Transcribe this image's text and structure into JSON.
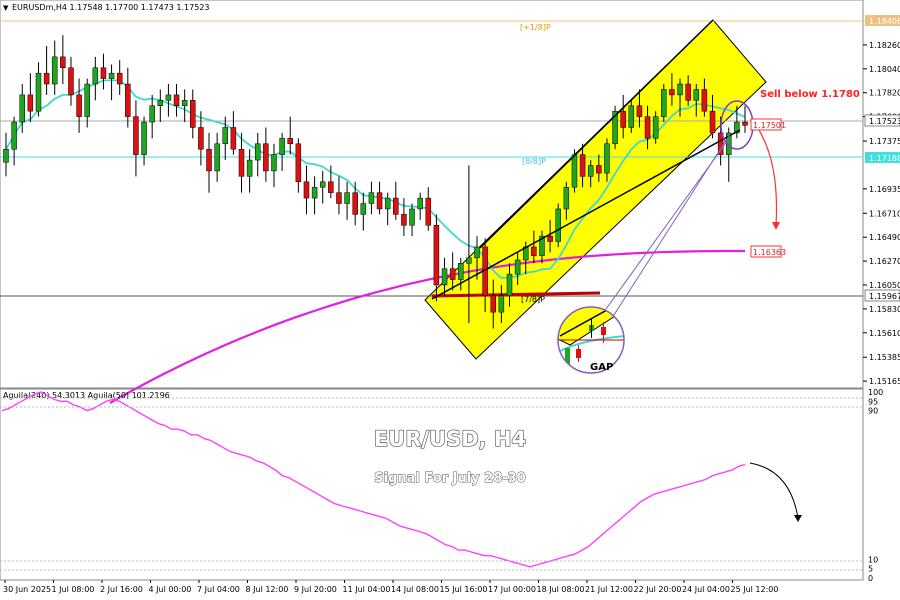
{
  "header": {
    "symbol_line": "EURUSDm,H4  1.17548 1.17700 1.17473 1.17523",
    "indicator_line": "Aguila(240) 54.3013  Aguila(50) 101.2196"
  },
  "annotations": {
    "sell_text": "Sell below 1.1780",
    "gap_label": "GAP",
    "title": "EUR/USD,  H4",
    "subtitle": "Signal For July 28-30",
    "murrey_top": "[+1/8]P",
    "murrey_mid": "[8/8]P",
    "murrey_low": "[7/8]P"
  },
  "levels": {
    "top": "1.18406",
    "current": "1.17523",
    "red_box": "1.17501",
    "cyan": "1.17188",
    "ma200": "1.16363",
    "support": "1.15967"
  },
  "colors": {
    "candle_up": "#1fa51f",
    "candle_down": "#e01010",
    "ma_fast": "#40d8d0",
    "ma_slow": "#e020e0",
    "channel_fill": "#ffff00",
    "support_line": "#c00000",
    "oscillator": "#ff40ff",
    "arrow_red": "#ff3030"
  },
  "chart_data": [
    {
      "type": "candlestick",
      "title": "EUR/USD,  H4",
      "ylim": [
        1.1512,
        1.186
      ],
      "price_ticks": [
        "1.18260",
        "1.18040",
        "1.17820",
        "1.17600",
        "1.17375",
        "1.16935",
        "1.16710",
        "1.16490",
        "1.16270",
        "1.16050",
        "1.15830",
        "1.15610",
        "1.15385",
        "1.15165"
      ],
      "time_ticks": [
        "30 Jun 2025",
        "1 Jul 08:00",
        "2 Jul 16:00",
        "4 Jul 00:00",
        "7 Jul 04:00",
        "8 Jul 12:00",
        "9 Jul 20:00",
        "11 Jul 04:00",
        "14 Jul 08:00",
        "15 Jul 16:00",
        "17 Jul 00:00",
        "18 Jul 08:00",
        "21 Jul 12:00",
        "22 Jul 20:00",
        "24 Jul 04:00",
        "25 Jul 12:00"
      ],
      "last_ohlc": {
        "open": 1.17548,
        "high": 1.177,
        "low": 1.17473,
        "close": 1.17523
      },
      "moving_averages": [
        {
          "period": 21,
          "last": 1.1748
        },
        {
          "period": 200,
          "last": 1.16363
        }
      ],
      "ohlc": [
        [
          1.1718,
          1.1745,
          1.1705,
          1.173
        ],
        [
          1.173,
          1.176,
          1.1715,
          1.1755
        ],
        [
          1.1755,
          1.179,
          1.1745,
          1.178
        ],
        [
          1.178,
          1.18,
          1.1755,
          1.1765
        ],
        [
          1.1765,
          1.181,
          1.176,
          1.18
        ],
        [
          1.18,
          1.1825,
          1.178,
          1.179
        ],
        [
          1.179,
          1.183,
          1.178,
          1.1815
        ],
        [
          1.1815,
          1.1835,
          1.179,
          1.1805
        ],
        [
          1.1805,
          1.1815,
          1.177,
          1.178
        ],
        [
          1.178,
          1.1795,
          1.1745,
          1.176
        ],
        [
          1.176,
          1.1795,
          1.175,
          1.179
        ],
        [
          1.179,
          1.1815,
          1.1775,
          1.1805
        ],
        [
          1.1805,
          1.1818,
          1.1785,
          1.1795
        ],
        [
          1.1795,
          1.1808,
          1.1775,
          1.18
        ],
        [
          1.18,
          1.1812,
          1.178,
          1.179
        ],
        [
          1.179,
          1.1805,
          1.175,
          1.176
        ],
        [
          1.176,
          1.1775,
          1.1705,
          1.1725
        ],
        [
          1.1725,
          1.176,
          1.1715,
          1.1755
        ],
        [
          1.1755,
          1.178,
          1.174,
          1.177
        ],
        [
          1.177,
          1.1785,
          1.1755,
          1.1775
        ],
        [
          1.1775,
          1.179,
          1.176,
          1.178
        ],
        [
          1.178,
          1.179,
          1.176,
          1.177
        ],
        [
          1.177,
          1.1785,
          1.1755,
          1.1775
        ],
        [
          1.1775,
          1.1785,
          1.174,
          1.175
        ],
        [
          1.175,
          1.1765,
          1.1715,
          1.173
        ],
        [
          1.173,
          1.1745,
          1.169,
          1.171
        ],
        [
          1.171,
          1.1745,
          1.17,
          1.1735
        ],
        [
          1.1735,
          1.176,
          1.172,
          1.175
        ],
        [
          1.175,
          1.1765,
          1.1725,
          1.173
        ],
        [
          1.173,
          1.1745,
          1.169,
          1.1705
        ],
        [
          1.1705,
          1.173,
          1.169,
          1.172
        ],
        [
          1.172,
          1.1745,
          1.1705,
          1.1735
        ],
        [
          1.1735,
          1.175,
          1.17,
          1.171
        ],
        [
          1.171,
          1.1735,
          1.1695,
          1.1725
        ],
        [
          1.1725,
          1.1745,
          1.171,
          1.174
        ],
        [
          1.174,
          1.176,
          1.1725,
          1.1735
        ],
        [
          1.1735,
          1.174,
          1.169,
          1.17
        ],
        [
          1.17,
          1.1715,
          1.167,
          1.1685
        ],
        [
          1.1685,
          1.1705,
          1.167,
          1.1695
        ],
        [
          1.1695,
          1.171,
          1.168,
          1.17
        ],
        [
          1.17,
          1.1715,
          1.1685,
          1.169
        ],
        [
          1.169,
          1.1705,
          1.167,
          1.168
        ],
        [
          1.168,
          1.17,
          1.1665,
          1.169
        ],
        [
          1.169,
          1.17,
          1.166,
          1.167
        ],
        [
          1.167,
          1.169,
          1.1655,
          1.168
        ],
        [
          1.168,
          1.17,
          1.167,
          1.169
        ],
        [
          1.169,
          1.17,
          1.167,
          1.1675
        ],
        [
          1.1675,
          1.169,
          1.166,
          1.1685
        ],
        [
          1.1685,
          1.17,
          1.1665,
          1.167
        ],
        [
          1.167,
          1.1685,
          1.165,
          1.166
        ],
        [
          1.166,
          1.168,
          1.165,
          1.1675
        ],
        [
          1.1675,
          1.169,
          1.1665,
          1.1685
        ],
        [
          1.1685,
          1.1695,
          1.1655,
          1.166
        ],
        [
          1.166,
          1.167,
          1.159,
          1.1605
        ],
        [
          1.1605,
          1.163,
          1.1595,
          1.162
        ],
        [
          1.162,
          1.1635,
          1.16,
          1.161
        ],
        [
          1.161,
          1.163,
          1.16,
          1.1625
        ],
        [
          1.1625,
          1.1715,
          1.157,
          1.163
        ],
        [
          1.163,
          1.165,
          1.161,
          1.164
        ],
        [
          1.164,
          1.1648,
          1.158,
          1.1595
        ],
        [
          1.1595,
          1.161,
          1.1565,
          1.158
        ],
        [
          1.158,
          1.1605,
          1.157,
          1.1595
        ],
        [
          1.1595,
          1.1625,
          1.1585,
          1.1615
        ],
        [
          1.1615,
          1.1635,
          1.1605,
          1.1628
        ],
        [
          1.1628,
          1.1645,
          1.1615,
          1.164
        ],
        [
          1.164,
          1.1655,
          1.1625,
          1.1632
        ],
        [
          1.1632,
          1.1655,
          1.1625,
          1.165
        ],
        [
          1.165,
          1.1665,
          1.1635,
          1.1645
        ],
        [
          1.1645,
          1.168,
          1.164,
          1.1675
        ],
        [
          1.1675,
          1.17,
          1.1665,
          1.1695
        ],
        [
          1.1695,
          1.173,
          1.169,
          1.1725
        ],
        [
          1.1725,
          1.1735,
          1.1695,
          1.1705
        ],
        [
          1.1705,
          1.172,
          1.1695,
          1.1715
        ],
        [
          1.1715,
          1.1725,
          1.17,
          1.1708
        ],
        [
          1.1708,
          1.174,
          1.17,
          1.1735
        ],
        [
          1.1735,
          1.177,
          1.173,
          1.1765
        ],
        [
          1.1765,
          1.178,
          1.174,
          1.175
        ],
        [
          1.175,
          1.1775,
          1.1745,
          1.177
        ],
        [
          1.177,
          1.1785,
          1.175,
          1.176
        ],
        [
          1.176,
          1.177,
          1.173,
          1.174
        ],
        [
          1.174,
          1.1765,
          1.1735,
          1.176
        ],
        [
          1.176,
          1.179,
          1.1755,
          1.1785
        ],
        [
          1.1785,
          1.18,
          1.177,
          1.178
        ],
        [
          1.178,
          1.1795,
          1.176,
          1.179
        ],
        [
          1.179,
          1.1798,
          1.177,
          1.1775
        ],
        [
          1.1775,
          1.179,
          1.176,
          1.1785
        ],
        [
          1.1785,
          1.1795,
          1.176,
          1.1765
        ],
        [
          1.1765,
          1.178,
          1.174,
          1.1745
        ],
        [
          1.1745,
          1.176,
          1.1715,
          1.1725
        ],
        [
          1.1725,
          1.175,
          1.17,
          1.1745
        ],
        [
          1.1745,
          1.177,
          1.174,
          1.1755
        ],
        [
          1.1755,
          1.177,
          1.1745,
          1.1752
        ]
      ]
    },
    {
      "type": "line",
      "title": "Aguila(240) 54.3013  Aguila(50) 101.2196",
      "ylim": [
        0,
        100
      ],
      "y_ticks": [
        "100",
        "95",
        "90",
        "10",
        "5",
        "0"
      ],
      "series": [
        {
          "name": "Aguila(50)",
          "values": [
            90,
            91,
            93,
            95,
            97,
            99,
            100,
            98,
            96,
            95,
            95,
            93,
            92,
            90,
            91,
            93,
            95,
            96,
            95,
            93,
            91,
            89,
            87,
            85,
            83,
            82,
            80,
            80,
            79,
            77,
            77,
            75,
            74,
            72,
            70,
            68,
            67,
            66,
            65,
            63,
            62,
            60,
            58,
            55,
            54,
            52,
            50,
            48,
            46,
            44,
            42,
            40,
            39,
            38,
            37,
            36,
            35,
            34,
            33,
            32,
            30,
            28,
            27,
            26,
            25,
            24,
            22,
            20,
            18,
            17,
            15,
            15,
            14,
            13,
            12,
            12,
            11,
            10,
            9,
            8,
            7,
            6,
            7,
            8,
            9,
            10,
            11,
            12,
            13,
            15,
            17,
            20,
            23,
            26,
            29,
            32,
            35,
            38,
            41,
            43,
            45,
            46,
            47,
            48,
            49,
            50,
            51,
            52,
            53,
            55,
            56,
            57,
            58,
            60,
            61
          ]
        }
      ]
    }
  ]
}
